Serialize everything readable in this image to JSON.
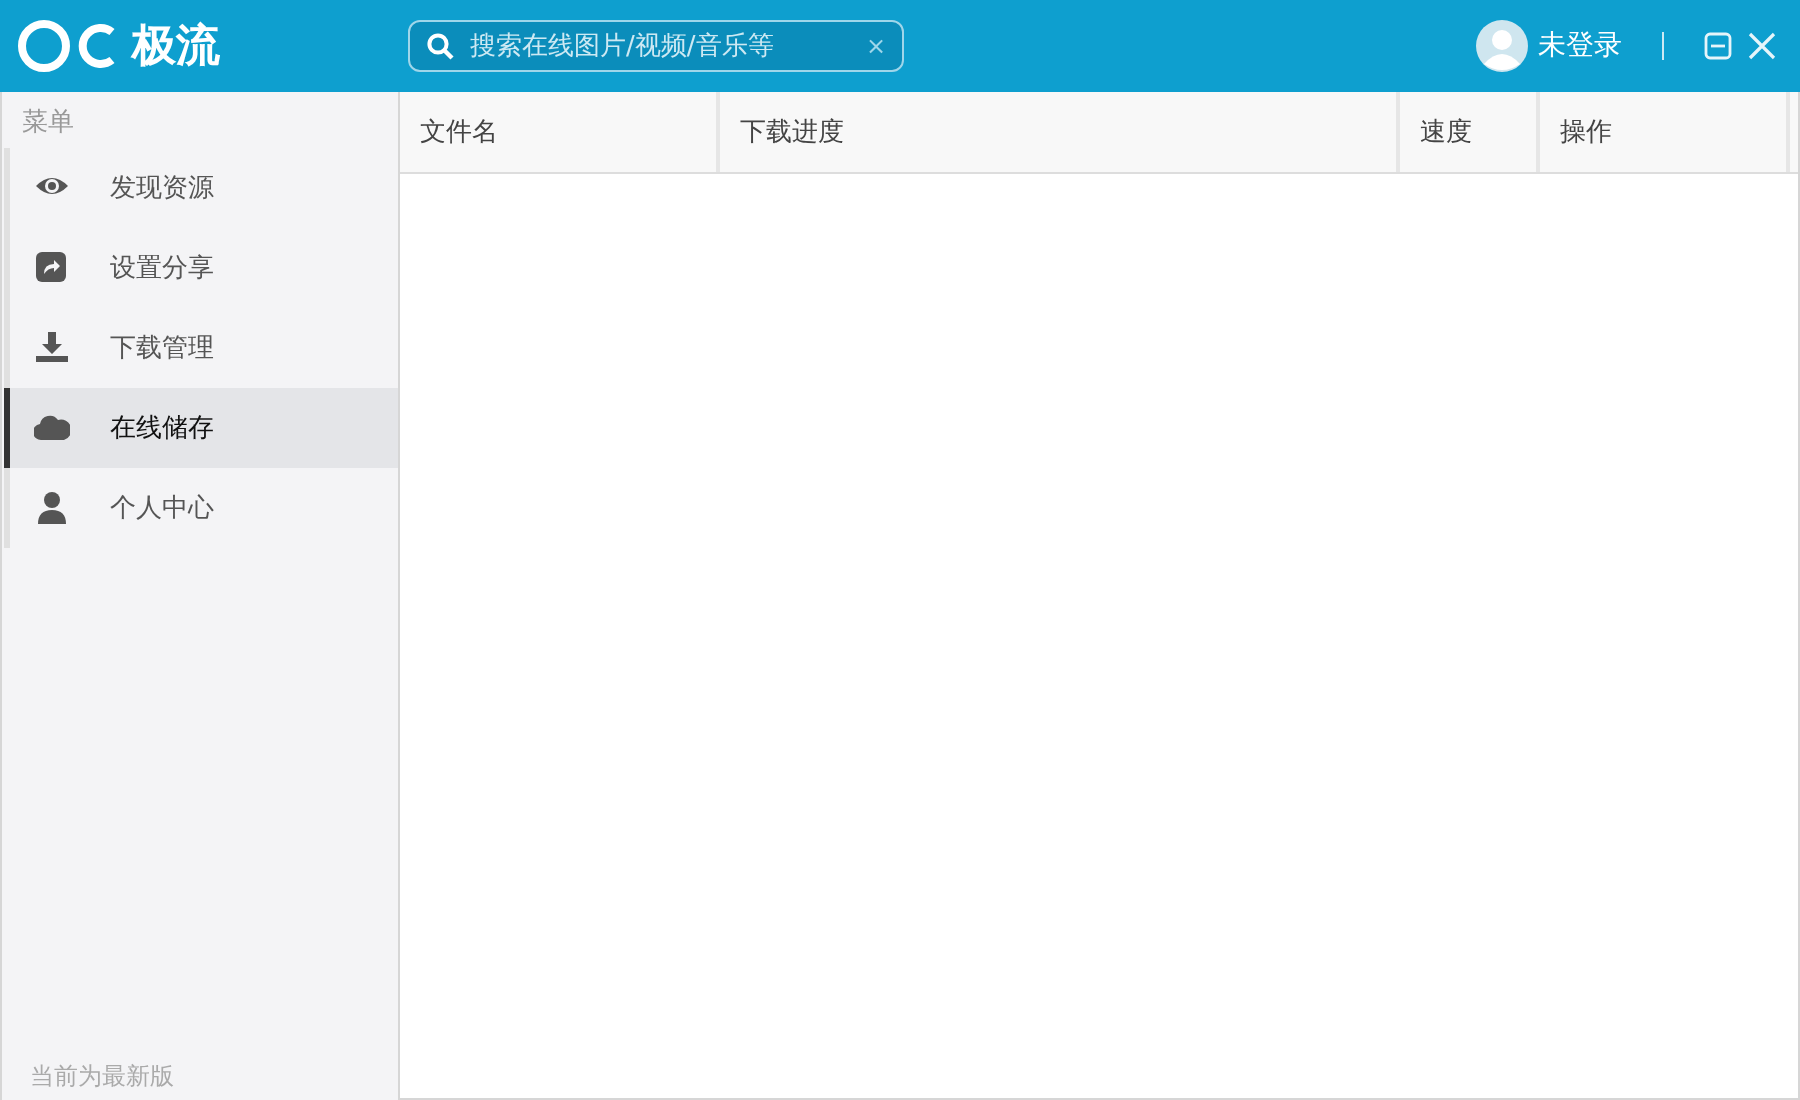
{
  "app": {
    "logo_text": "极流"
  },
  "search": {
    "placeholder": "搜索在线图片/视频/音乐等",
    "clear": "×"
  },
  "user": {
    "label": "未登录"
  },
  "sidebar": {
    "header": "菜单",
    "items": [
      {
        "label": "发现资源",
        "selected": false
      },
      {
        "label": "设置分享",
        "selected": false
      },
      {
        "label": "下载管理",
        "selected": false
      },
      {
        "label": "在线储存",
        "selected": true
      },
      {
        "label": "个人中心",
        "selected": false
      }
    ],
    "footer": "当前为最新版"
  },
  "table": {
    "columns": [
      "文件名",
      "下载进度",
      "速度",
      "操作"
    ]
  }
}
